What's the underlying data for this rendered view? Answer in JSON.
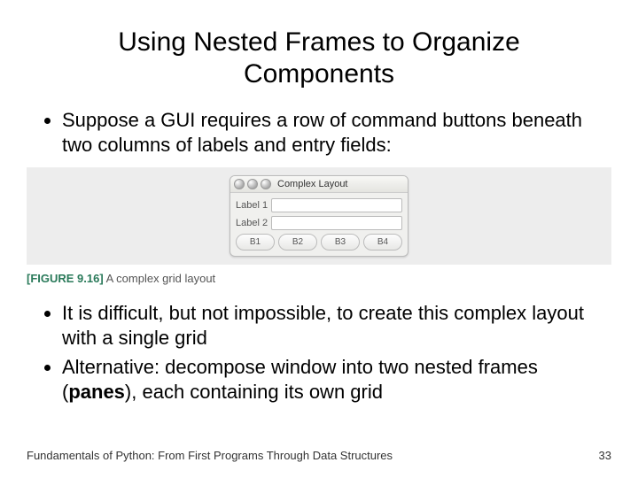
{
  "title": "Using Nested Frames to Organize Components",
  "bullets1": [
    "Suppose a GUI requires a row of command buttons beneath two columns of labels and entry fields:"
  ],
  "window": {
    "title": "Complex Layout",
    "labels": [
      "Label 1",
      "Label 2"
    ],
    "buttons": [
      "B1",
      "B2",
      "B3",
      "B4"
    ]
  },
  "figure": {
    "label": "[FIGURE 9.16]",
    "caption": "A complex grid layout"
  },
  "bullets2": [
    "It is difficult, but not impossible, to create this complex layout with a single grid",
    "Alternative: decompose window into two nested frames (panes), each containing its own grid"
  ],
  "bullets2_html": {
    "alt_prefix": "Alternative: decompose window into two nested frames (",
    "alt_bold": "panes",
    "alt_suffix": "), each containing its own grid"
  },
  "footer": {
    "book": "Fundamentals of Python: From First Programs Through Data Structures",
    "page": "33"
  }
}
